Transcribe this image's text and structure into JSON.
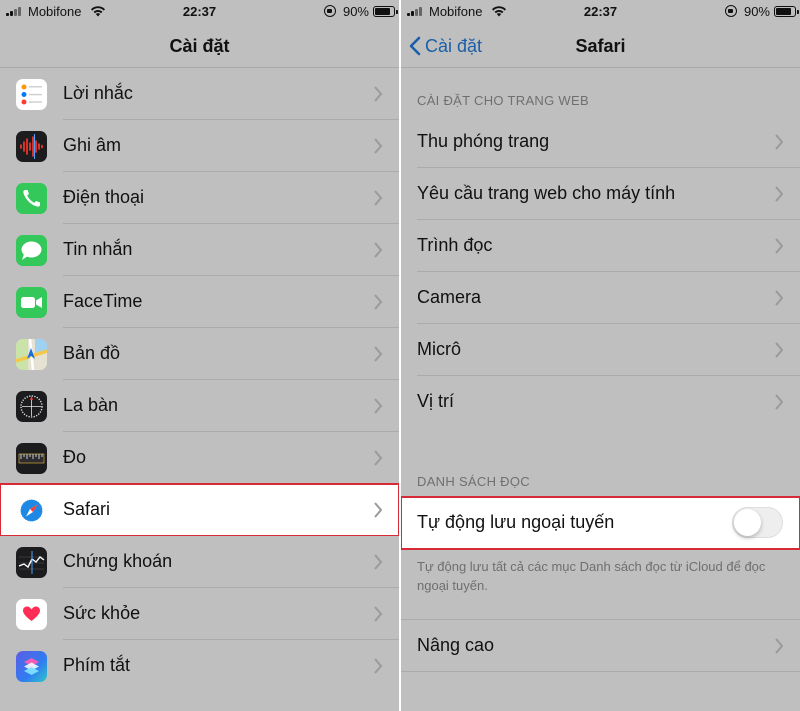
{
  "status_left": {
    "carrier": "Mobifone",
    "time": "22:37",
    "battery": "90%",
    "battery_level": 0.9
  },
  "status_right": {
    "carrier": "Mobifone",
    "time": "22:37",
    "battery": "90%",
    "battery_level": 0.9
  },
  "settings": {
    "title": "Cài đặt",
    "items": [
      {
        "label": "Lời nhắc",
        "icon": "reminders-icon"
      },
      {
        "label": "Ghi âm",
        "icon": "voice-memos-icon"
      },
      {
        "label": "Điện thoại",
        "icon": "phone-icon"
      },
      {
        "label": "Tin nhắn",
        "icon": "messages-icon"
      },
      {
        "label": "FaceTime",
        "icon": "facetime-icon"
      },
      {
        "label": "Bản đồ",
        "icon": "maps-icon"
      },
      {
        "label": "La bàn",
        "icon": "compass-icon"
      },
      {
        "label": "Đo",
        "icon": "measure-icon"
      },
      {
        "label": "Safari",
        "icon": "safari-icon",
        "selected": true
      },
      {
        "label": "Chứng khoán",
        "icon": "stocks-icon"
      },
      {
        "label": "Sức khỏe",
        "icon": "health-icon"
      },
      {
        "label": "Phím tắt",
        "icon": "shortcuts-icon"
      }
    ]
  },
  "safari": {
    "back_label": "Cài đặt",
    "title": "Safari",
    "web_section_header": "CÀI ĐẶT CHO TRANG WEB",
    "web_items": [
      "Thu phóng trang",
      "Yêu cầu trang web cho máy tính",
      "Trình đọc",
      "Camera",
      "Micrô",
      "Vị trí"
    ],
    "reading_list_header": "DANH SÁCH ĐỌC",
    "offline_label": "Tự động lưu ngoại tuyến",
    "offline_enabled": false,
    "offline_footer": "Tự động lưu tất cả các mục Danh sách đọc từ iCloud để đọc ngoại tuyến.",
    "advanced_label": "Nâng cao"
  },
  "colors": {
    "highlight_border": "#d62b36",
    "link_blue": "#1a5fa8",
    "panel_bg": "#bfbfbf"
  }
}
